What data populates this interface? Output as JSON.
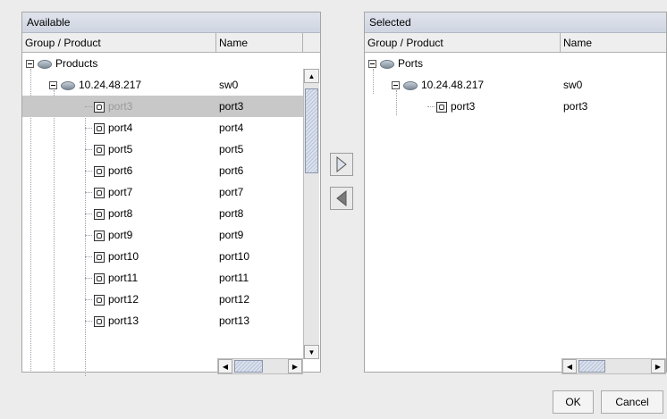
{
  "available": {
    "title": "Available",
    "col_group": "Group / Product",
    "col_name": "Name",
    "root_label": "Products",
    "host_label": "10.24.48.217",
    "host_name": "sw0",
    "ports": [
      {
        "label": "port3",
        "name": "port3",
        "selected": true
      },
      {
        "label": "port4",
        "name": "port4"
      },
      {
        "label": "port5",
        "name": "port5"
      },
      {
        "label": "port6",
        "name": "port6"
      },
      {
        "label": "port7",
        "name": "port7"
      },
      {
        "label": "port8",
        "name": "port8"
      },
      {
        "label": "port9",
        "name": "port9"
      },
      {
        "label": "port10",
        "name": "port10"
      },
      {
        "label": "port11",
        "name": "port11"
      },
      {
        "label": "port12",
        "name": "port12"
      },
      {
        "label": "port13",
        "name": "port13"
      }
    ]
  },
  "selected": {
    "title": "Selected",
    "col_group": "Group / Product",
    "col_name": "Name",
    "root_label": "Ports",
    "host_label": "10.24.48.217",
    "host_name": "sw0",
    "ports": [
      {
        "label": "port3",
        "name": "port3"
      }
    ]
  },
  "buttons": {
    "ok": "OK",
    "cancel": "Cancel"
  },
  "colors": {
    "selected_row": "#c8c8c8",
    "title_bar": "#d6dbe6",
    "background": "#ececec"
  }
}
